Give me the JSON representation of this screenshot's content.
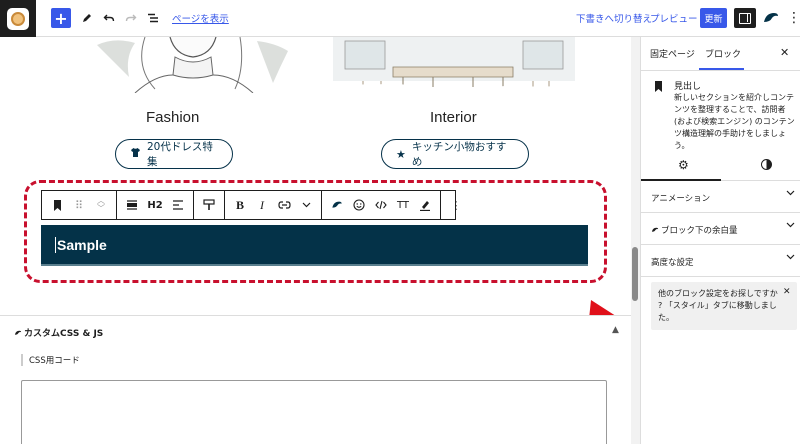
{
  "topbar": {
    "add_icon": "plus-icon",
    "view_page_link": "ページを表示",
    "draft_link": "下書きへ切り替え",
    "preview_link": "プレビュー",
    "update_button": "更新"
  },
  "canvas": {
    "columns": [
      {
        "caption": "Fashion",
        "button_label": "20代ドレス特集",
        "button_icon": "shirt-icon"
      },
      {
        "caption": "Interior",
        "button_label": "キッチン小物おすすめ",
        "button_icon": "star-icon"
      }
    ],
    "block_toolbar": {
      "heading_level": "H2",
      "bold": "B",
      "italic": "I",
      "text_size": "TT"
    },
    "heading_text": "Sample",
    "annotation_color": "#c8102e",
    "heading_bg_color": "#043248"
  },
  "meta_box": {
    "title": "カスタムCSS & JS",
    "css_label": "CSS用コード",
    "collapse_symbol": "▲"
  },
  "sidebar": {
    "tabs": [
      "固定ページ",
      "ブロック"
    ],
    "active_tab": "ブロック",
    "close_symbol": "✕",
    "block_name": "見出し",
    "block_description": "新しいセクションを紹介しコンテンツを整理することで、訪問者 (および検索エンジン) のコンテンツ構造理解の手助けをしましょう。",
    "panels": [
      "アニメーション",
      "ブロック下の余白量",
      "高度な設定"
    ],
    "notice_text": "他のブロック設定をお探しですか ? 「スタイル」タブに移動しました。",
    "notice_close": "✕"
  }
}
